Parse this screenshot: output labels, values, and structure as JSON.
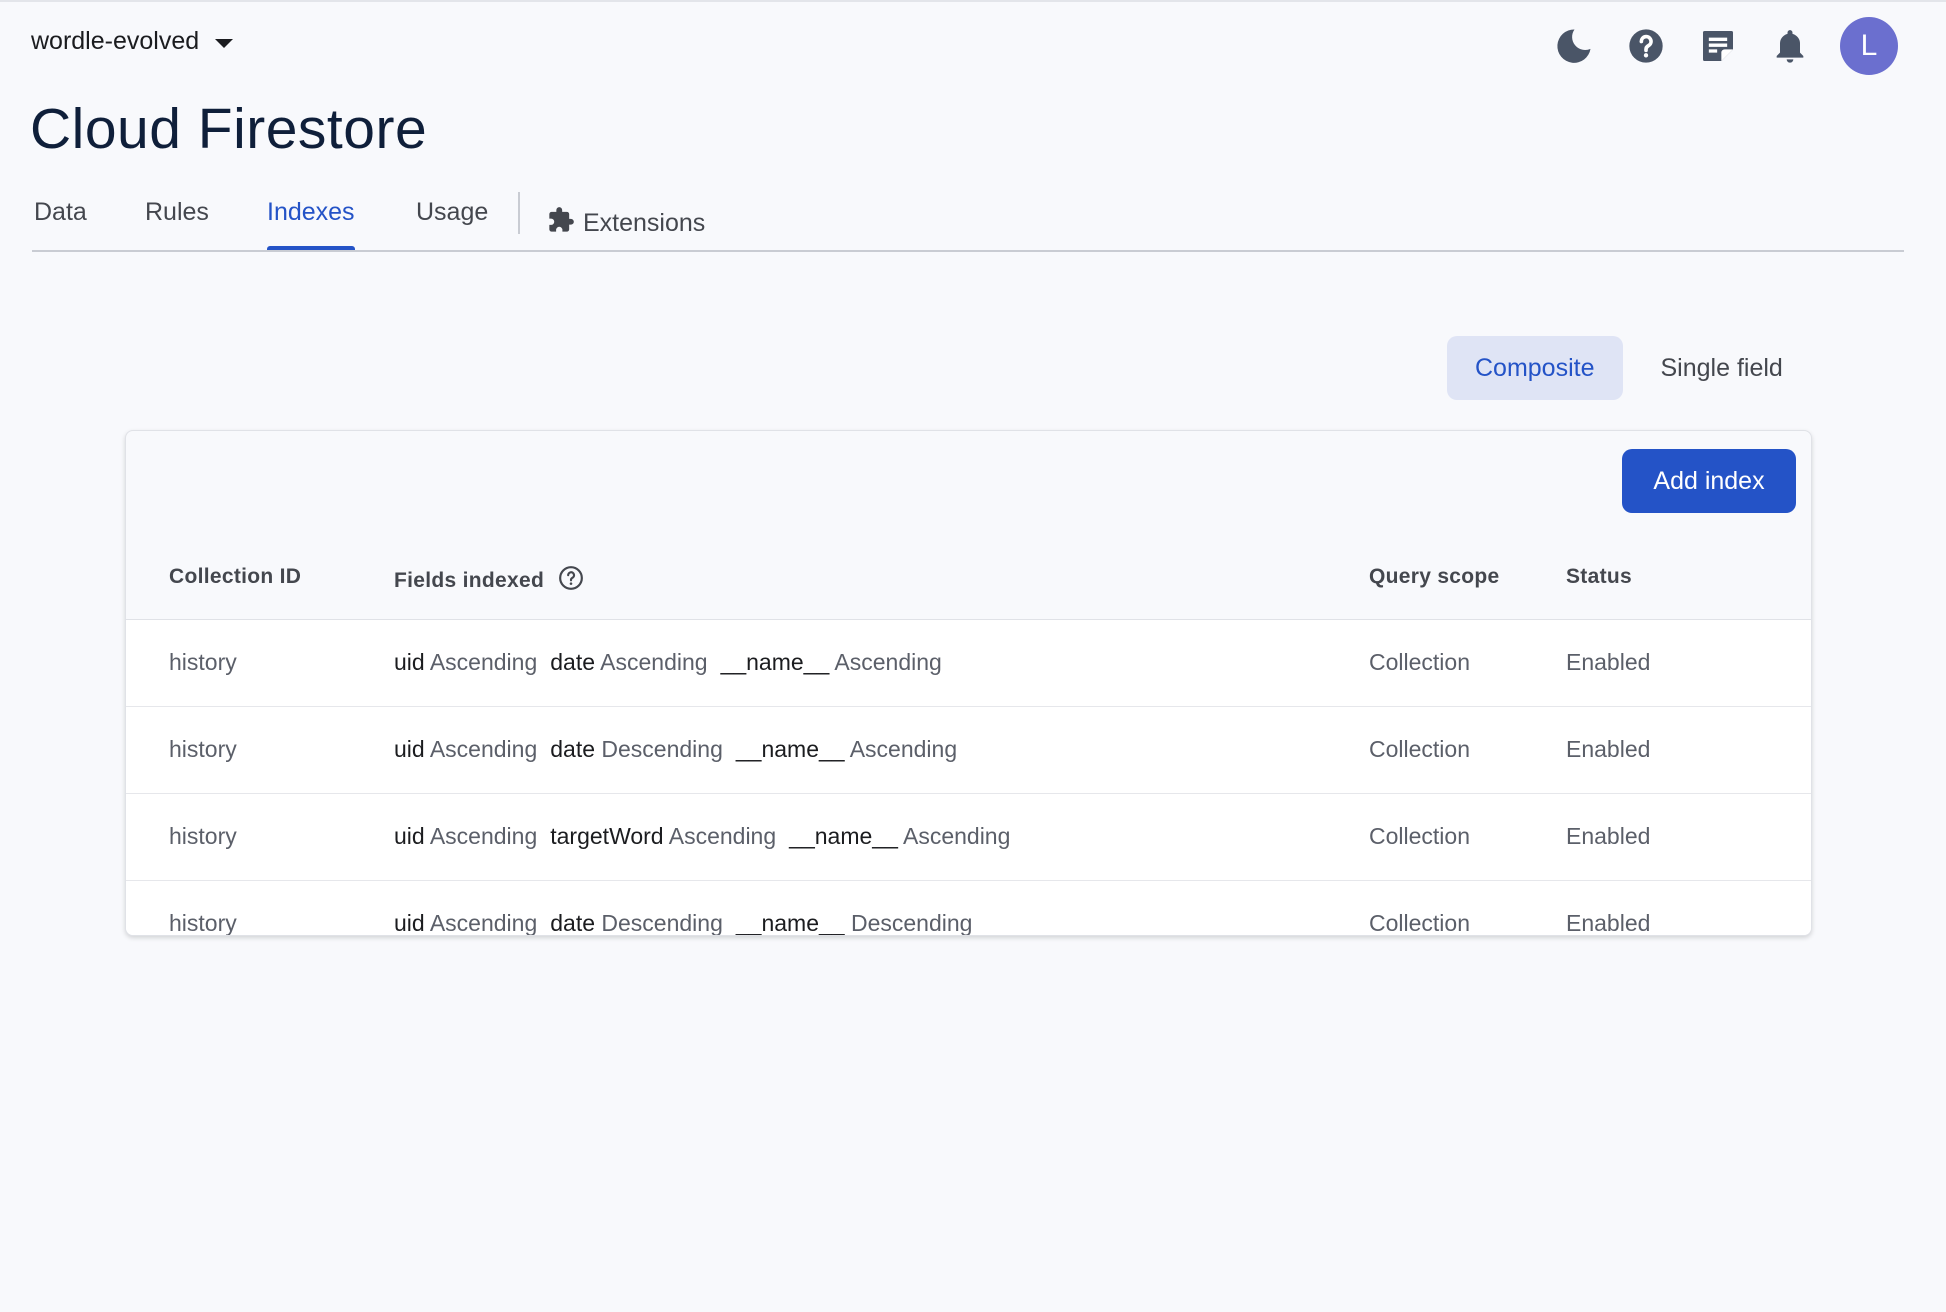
{
  "project": {
    "name": "wordle-evolved"
  },
  "header": {
    "title": "Cloud Firestore",
    "avatar_initial": "L"
  },
  "tabs": [
    {
      "label": "Data"
    },
    {
      "label": "Rules"
    },
    {
      "label": "Indexes"
    },
    {
      "label": "Usage"
    },
    {
      "label": "Extensions"
    }
  ],
  "segment": {
    "composite": "Composite",
    "single_field": "Single field"
  },
  "table": {
    "add_button": "Add index",
    "headers": {
      "collection_id": "Collection ID",
      "fields_indexed": "Fields indexed",
      "query_scope": "Query scope",
      "status": "Status"
    },
    "rows": [
      {
        "collection": "history",
        "fields": [
          {
            "name": "uid",
            "order": "Ascending"
          },
          {
            "name": "date",
            "order": "Ascending"
          },
          {
            "name": "__name__",
            "order": "Ascending"
          }
        ],
        "scope": "Collection",
        "status": "Enabled"
      },
      {
        "collection": "history",
        "fields": [
          {
            "name": "uid",
            "order": "Ascending"
          },
          {
            "name": "date",
            "order": "Descending"
          },
          {
            "name": "__name__",
            "order": "Ascending"
          }
        ],
        "scope": "Collection",
        "status": "Enabled"
      },
      {
        "collection": "history",
        "fields": [
          {
            "name": "uid",
            "order": "Ascending"
          },
          {
            "name": "targetWord",
            "order": "Ascending"
          },
          {
            "name": "__name__",
            "order": "Ascending"
          }
        ],
        "scope": "Collection",
        "status": "Enabled"
      },
      {
        "collection": "history",
        "fields": [
          {
            "name": "uid",
            "order": "Ascending"
          },
          {
            "name": "date",
            "order": "Descending"
          },
          {
            "name": "__name__",
            "order": "Descending"
          }
        ],
        "scope": "Collection",
        "status": "Enabled"
      }
    ]
  },
  "colors": {
    "accent": "#2453c7",
    "accent_soft": "#dfe4f5",
    "avatar": "#6b6fcf",
    "icon": "#4a5567"
  },
  "icons": [
    "dark-mode-icon",
    "help-icon",
    "release-notes-icon",
    "notifications-icon",
    "extensions-icon",
    "help-circle-icon",
    "caret-down-icon"
  ]
}
